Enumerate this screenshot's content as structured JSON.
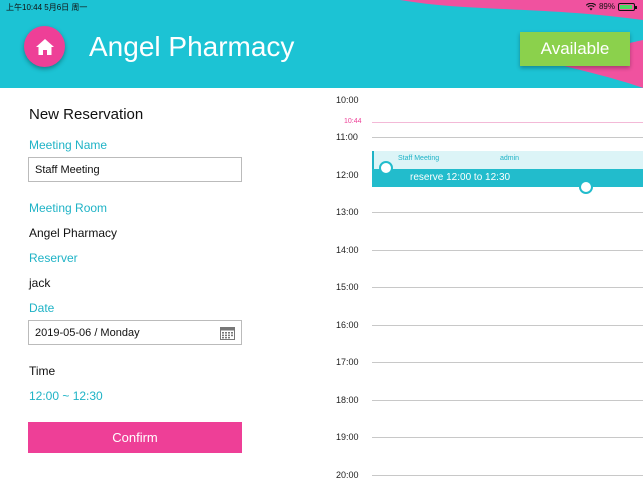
{
  "status_bar": {
    "time": "上午10:44 5月6日 周一",
    "battery": "89%"
  },
  "header": {
    "title": "Angel Pharmacy",
    "available_label": "Available"
  },
  "form": {
    "title": "New Reservation",
    "meeting_name_label": "Meeting Name",
    "meeting_name_value": "Staff Meeting",
    "meeting_room_label": "Meeting Room",
    "meeting_room_value": "Angel Pharmacy",
    "reserver_label": "Reserver",
    "reserver_value": "jack",
    "date_label": "Date",
    "date_value": "2019-05-06 / Monday",
    "time_label": "Time",
    "time_value": "12:00 ~ 12:30",
    "confirm_label": "Confirm"
  },
  "timeline": {
    "hours": [
      "10:00",
      "11:00",
      "12:00",
      "13:00",
      "14:00",
      "15:00",
      "16:00",
      "17:00",
      "18:00",
      "19:00",
      "20:00"
    ],
    "now_label": "10:44",
    "event": {
      "name": "Staff Meeting",
      "user": "admin"
    },
    "reserve_text": "reserve 12:00 to 12:30"
  },
  "colors": {
    "accent": "#1cc3d4",
    "brand_pink": "#ee3f97",
    "available": "#8bd14c"
  }
}
